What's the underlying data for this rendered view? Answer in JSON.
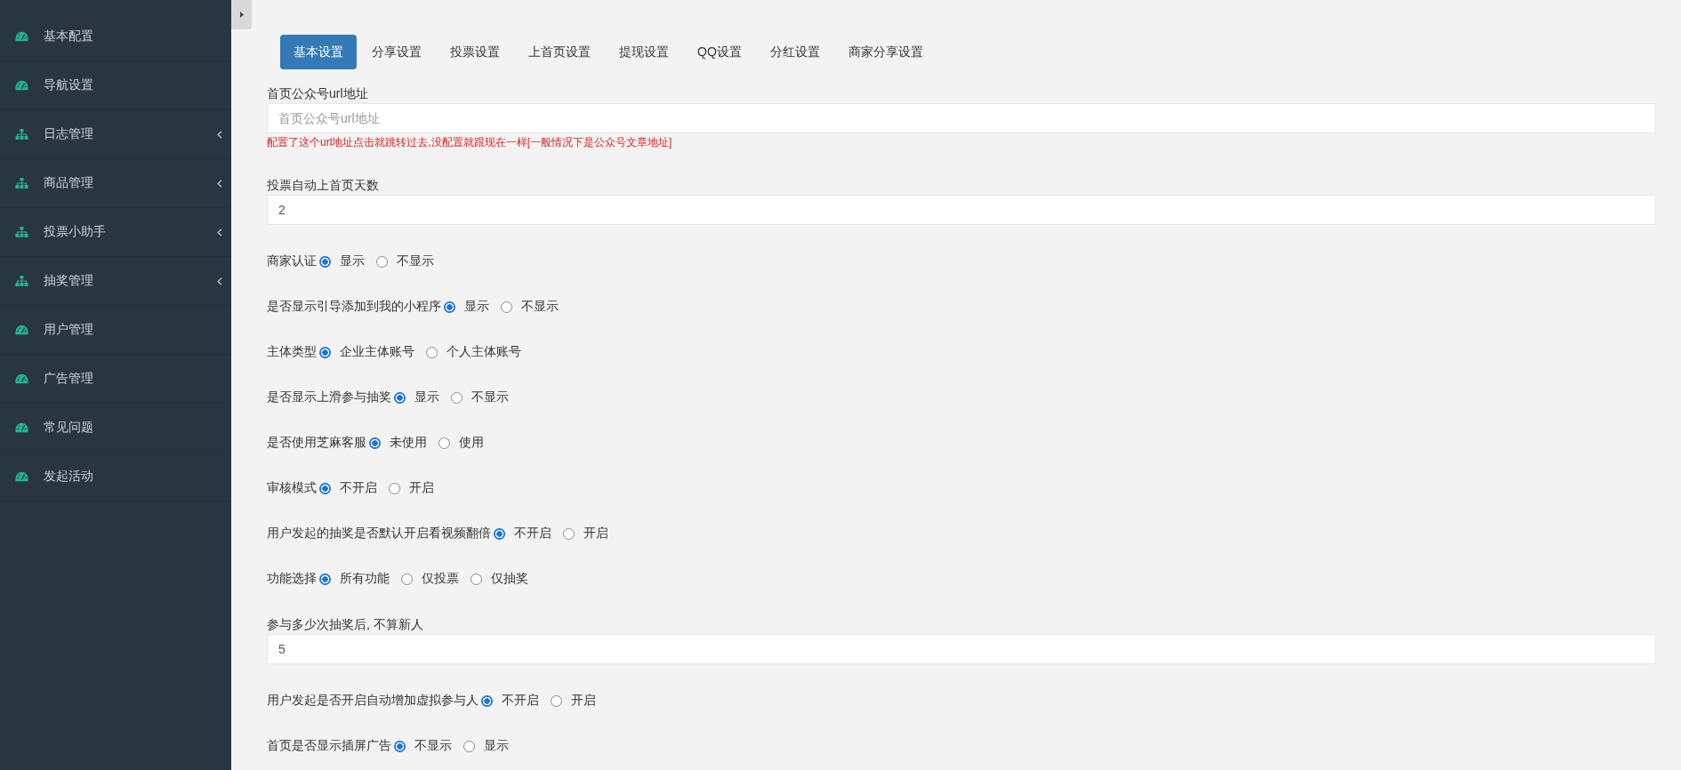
{
  "sidebar": {
    "items": [
      {
        "label": "基本配置",
        "kind": "link"
      },
      {
        "label": "导航设置",
        "kind": "link"
      },
      {
        "label": "日志管理",
        "kind": "group"
      },
      {
        "label": "商品管理",
        "kind": "group"
      },
      {
        "label": "投票小助手",
        "kind": "group"
      },
      {
        "label": "抽奖管理",
        "kind": "group"
      },
      {
        "label": "用户管理",
        "kind": "link"
      },
      {
        "label": "广告管理",
        "kind": "link"
      },
      {
        "label": "常见问题",
        "kind": "link"
      },
      {
        "label": "发起活动",
        "kind": "link"
      }
    ]
  },
  "tabs": [
    {
      "label": "基本设置",
      "selected": true
    },
    {
      "label": "分享设置",
      "selected": false
    },
    {
      "label": "投票设置",
      "selected": false
    },
    {
      "label": "上首页设置",
      "selected": false
    },
    {
      "label": "提现设置",
      "selected": false
    },
    {
      "label": "QQ设置",
      "selected": false
    },
    {
      "label": "分红设置",
      "selected": false
    },
    {
      "label": "商家分享设置",
      "selected": false
    }
  ],
  "form": {
    "fields": [
      {
        "kind": "text",
        "label": "首页公众号url地址",
        "placeholder": "首页公众号url地址",
        "hint": "配置了这个url地址点击就跳转过去,没配置就跟现在一样[一般情况下是公众号文章地址]"
      },
      {
        "kind": "text",
        "label": "投票自动上首页天数",
        "value": "2"
      },
      {
        "kind": "radio",
        "label": "商家认证",
        "options": [
          {
            "label": "显示",
            "selected": true
          },
          {
            "label": "不显示",
            "selected": false
          }
        ]
      },
      {
        "kind": "radio",
        "label": "是否显示引导添加到我的小程序",
        "options": [
          {
            "label": "显示",
            "selected": true
          },
          {
            "label": "不显示",
            "selected": false
          }
        ]
      },
      {
        "kind": "radio",
        "label": "主体类型",
        "options": [
          {
            "label": "企业主体账号",
            "selected": true
          },
          {
            "label": "个人主体账号",
            "selected": false
          }
        ]
      },
      {
        "kind": "radio",
        "label": "是否显示上滑参与抽奖",
        "options": [
          {
            "label": "显示",
            "selected": true
          },
          {
            "label": "不显示",
            "selected": false
          }
        ]
      },
      {
        "kind": "radio",
        "label": "是否使用芝麻客服",
        "options": [
          {
            "label": "未使用",
            "selected": true
          },
          {
            "label": "使用",
            "selected": false
          }
        ]
      },
      {
        "kind": "radio",
        "label": "审核模式",
        "options": [
          {
            "label": "不开启",
            "selected": true
          },
          {
            "label": "开启",
            "selected": false
          }
        ]
      },
      {
        "kind": "radio",
        "label": "用户发起的抽奖是否默认开启看视频翻倍",
        "options": [
          {
            "label": "不开启",
            "selected": true
          },
          {
            "label": "开启",
            "selected": false
          }
        ]
      },
      {
        "kind": "radio",
        "label": "功能选择",
        "options": [
          {
            "label": "所有功能",
            "selected": true
          },
          {
            "label": "仅投票",
            "selected": false
          },
          {
            "label": "仅抽奖",
            "selected": false
          }
        ]
      },
      {
        "kind": "text",
        "label": "参与多少次抽奖后, 不算新人",
        "value": "5"
      },
      {
        "kind": "radio",
        "label": "用户发起是否开启自动增加虚拟参与人",
        "options": [
          {
            "label": "不开启",
            "selected": true
          },
          {
            "label": "开启",
            "selected": false
          }
        ]
      },
      {
        "kind": "radio",
        "label": "首页是否显示插屏广告",
        "options": [
          {
            "label": "不显示",
            "selected": true
          },
          {
            "label": "显示",
            "selected": false
          }
        ]
      }
    ]
  }
}
